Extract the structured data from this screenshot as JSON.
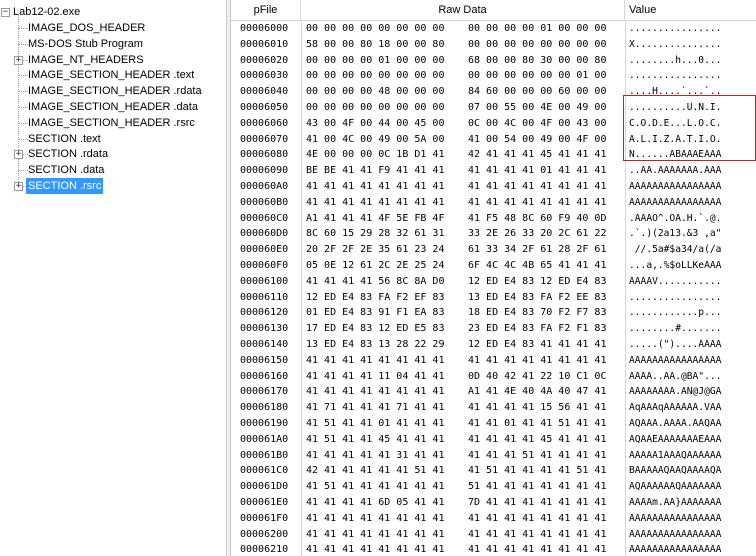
{
  "tree": {
    "root": "Lab12-02.exe",
    "items": [
      {
        "label": "IMAGE_DOS_HEADER",
        "expandable": false
      },
      {
        "label": "MS-DOS Stub Program",
        "expandable": false
      },
      {
        "label": "IMAGE_NT_HEADERS",
        "expandable": true
      },
      {
        "label": "IMAGE_SECTION_HEADER .text",
        "expandable": false
      },
      {
        "label": "IMAGE_SECTION_HEADER .rdata",
        "expandable": false
      },
      {
        "label": "IMAGE_SECTION_HEADER .data",
        "expandable": false
      },
      {
        "label": "IMAGE_SECTION_HEADER .rsrc",
        "expandable": false
      },
      {
        "label": "SECTION .text",
        "expandable": false
      },
      {
        "label": "SECTION .rdata",
        "expandable": true
      },
      {
        "label": "SECTION .data",
        "expandable": false
      },
      {
        "label": "SECTION .rsrc",
        "expandable": true,
        "selected": true
      }
    ]
  },
  "columns": {
    "pfile": "pFile",
    "raw": "Raw Data",
    "value": "Value"
  },
  "rows": [
    {
      "addr": "00006000",
      "hex1": "00 00 00 00 00 00 00 00",
      "hex2": "00 00 00 00 01 00 00 00",
      "value": "................"
    },
    {
      "addr": "00006010",
      "hex1": "58 00 00 80 18 00 00 80",
      "hex2": "00 00 00 00 00 00 00 00",
      "value": "X..............."
    },
    {
      "addr": "00006020",
      "hex1": "00 00 00 00 01 00 00 00",
      "hex2": "68 00 00 80 30 00 00 80",
      "value": "........h...0..."
    },
    {
      "addr": "00006030",
      "hex1": "00 00 00 00 00 00 00 00",
      "hex2": "00 00 00 00 00 00 01 00",
      "value": "................"
    },
    {
      "addr": "00006040",
      "hex1": "00 00 00 00 48 00 00 00",
      "hex2": "84 60 00 00 00 60 00 00",
      "value": "....H....`...`.."
    },
    {
      "addr": "00006050",
      "hex1": "00 00 00 00 00 00 00 00",
      "hex2": "07 00 55 00 4E 00 49 00",
      "value": "..........U.N.I."
    },
    {
      "addr": "00006060",
      "hex1": "43 00 4F 00 44 00 45 00",
      "hex2": "0C 00 4C 00 4F 00 43 00",
      "value": "C.O.D.E...L.O.C."
    },
    {
      "addr": "00006070",
      "hex1": "41 00 4C 00 49 00 5A 00",
      "hex2": "41 00 54 00 49 00 4F 00",
      "value": "A.L.I.Z.A.T.I.O."
    },
    {
      "addr": "00006080",
      "hex1": "4E 00 00 00 0C 1B D1 41",
      "hex2": "42 41 41 41 45 41 41 41",
      "value": "N......ABAAAEAAA"
    },
    {
      "addr": "00006090",
      "hex1": "BE BE 41 41 F9 41 41 41",
      "hex2": "41 41 41 41 01 41 41 41",
      "value": "..AA.AAAAAAA.AAA"
    },
    {
      "addr": "000060A0",
      "hex1": "41 41 41 41 41 41 41 41",
      "hex2": "41 41 41 41 41 41 41 41",
      "value": "AAAAAAAAAAAAAAAA"
    },
    {
      "addr": "000060B0",
      "hex1": "41 41 41 41 41 41 41 41",
      "hex2": "41 41 41 41 41 41 41 41",
      "value": "AAAAAAAAAAAAAAAA"
    },
    {
      "addr": "000060C0",
      "hex1": "A1 41 41 41 4F 5E FB 4F",
      "hex2": "41 F5 48 8C 60 F9 40 0D",
      "value": ".AAAO^.OA.H.`.@."
    },
    {
      "addr": "000060D0",
      "hex1": "8C 60 15 29 28 32 61 31",
      "hex2": "33 2E 26 33 20 2C 61 22",
      "value": ".`.)(2a13.&3 ,a\""
    },
    {
      "addr": "000060E0",
      "hex1": "20 2F 2F 2E 35 61 23 24",
      "hex2": "61 33 34 2F 61 28 2F 61",
      "value": " //.5a#$a34/a(/a"
    },
    {
      "addr": "000060F0",
      "hex1": "05 0E 12 61 2C 2E 25 24",
      "hex2": "6F 4C 4C 4B 65 41 41 41",
      "value": "...a,.%$oLLKeAAA"
    },
    {
      "addr": "00006100",
      "hex1": "41 41 41 41 56 8C 8A D0",
      "hex2": "12 ED E4 83 12 ED E4 83",
      "value": "AAAAV..........."
    },
    {
      "addr": "00006110",
      "hex1": "12 ED E4 83 FA F2 EF 83",
      "hex2": "13 ED E4 83 FA F2 EE 83",
      "value": "................"
    },
    {
      "addr": "00006120",
      "hex1": "01 ED E4 83 91 F1 EA 83",
      "hex2": "18 ED E4 83 70 F2 F7 83",
      "value": "............p..."
    },
    {
      "addr": "00006130",
      "hex1": "17 ED E4 83 12 ED E5 83",
      "hex2": "23 ED E4 83 FA F2 F1 83",
      "value": "........#......."
    },
    {
      "addr": "00006140",
      "hex1": "13 ED E4 83 13 28 22 29",
      "hex2": "12 ED E4 83 41 41 41 41",
      "value": ".....(\")....AAAA"
    },
    {
      "addr": "00006150",
      "hex1": "41 41 41 41 41 41 41 41",
      "hex2": "41 41 41 41 41 41 41 41",
      "value": "AAAAAAAAAAAAAAAA"
    },
    {
      "addr": "00006160",
      "hex1": "41 41 41 41 11 04 41 41",
      "hex2": "0D 40 42 41 22 10 C1 0C",
      "value": "AAAA..AA.@BA\"..."
    },
    {
      "addr": "00006170",
      "hex1": "41 41 41 41 41 41 41 41",
      "hex2": "A1 41 4E 40 4A 40 47 41",
      "value": "AAAAAAAA.AN@J@GA"
    },
    {
      "addr": "00006180",
      "hex1": "41 71 41 41 41 71 41 41",
      "hex2": "41 41 41 41 15 56 41 41",
      "value": "AqAAAqAAAAAA.VAA"
    },
    {
      "addr": "00006190",
      "hex1": "41 51 41 41 01 41 41 41",
      "hex2": "41 41 01 41 41 51 41 41",
      "value": "AQAAA.AAAA.AAQAA"
    },
    {
      "addr": "000061A0",
      "hex1": "41 51 41 41 45 41 41 41",
      "hex2": "41 41 41 41 45 41 41 41",
      "value": "AQAAEAAAAAAAEAAA"
    },
    {
      "addr": "000061B0",
      "hex1": "41 41 41 41 41 31 41 41",
      "hex2": "41 41 41 51 41 41 41 41",
      "value": "AAAAA1AAAQAAAAAA"
    },
    {
      "addr": "000061C0",
      "hex1": "42 41 41 41 41 41 51 41",
      "hex2": "41 51 41 41 41 41 51 41",
      "value": "BAAAAAQAAQAAAAQA"
    },
    {
      "addr": "000061D0",
      "hex1": "41 51 41 41 41 41 41 41",
      "hex2": "51 41 41 41 41 41 41 41",
      "value": "AQAAAAAAQAAAAAAA"
    },
    {
      "addr": "000061E0",
      "hex1": "41 41 41 41 6D 05 41 41",
      "hex2": "7D 41 41 41 41 41 41 41",
      "value": "AAAAm.AA}AAAAAAA"
    },
    {
      "addr": "000061F0",
      "hex1": "41 41 41 41 41 41 41 41",
      "hex2": "41 41 41 41 41 41 41 41",
      "value": "AAAAAAAAAAAAAAAA"
    },
    {
      "addr": "00006200",
      "hex1": "41 41 41 41 41 41 41 41",
      "hex2": "41 41 41 41 41 41 41 41",
      "value": "AAAAAAAAAAAAAAAA"
    },
    {
      "addr": "00006210",
      "hex1": "41 41 41 41 41 41 41 41",
      "hex2": "41 41 41 41 41 41 41 41",
      "value": "AAAAAAAAAAAAAAAA"
    }
  ],
  "colors": {
    "selection": "#3399ff",
    "highlight_box": "#c0202a",
    "grid_line": "#d6d6d6"
  }
}
